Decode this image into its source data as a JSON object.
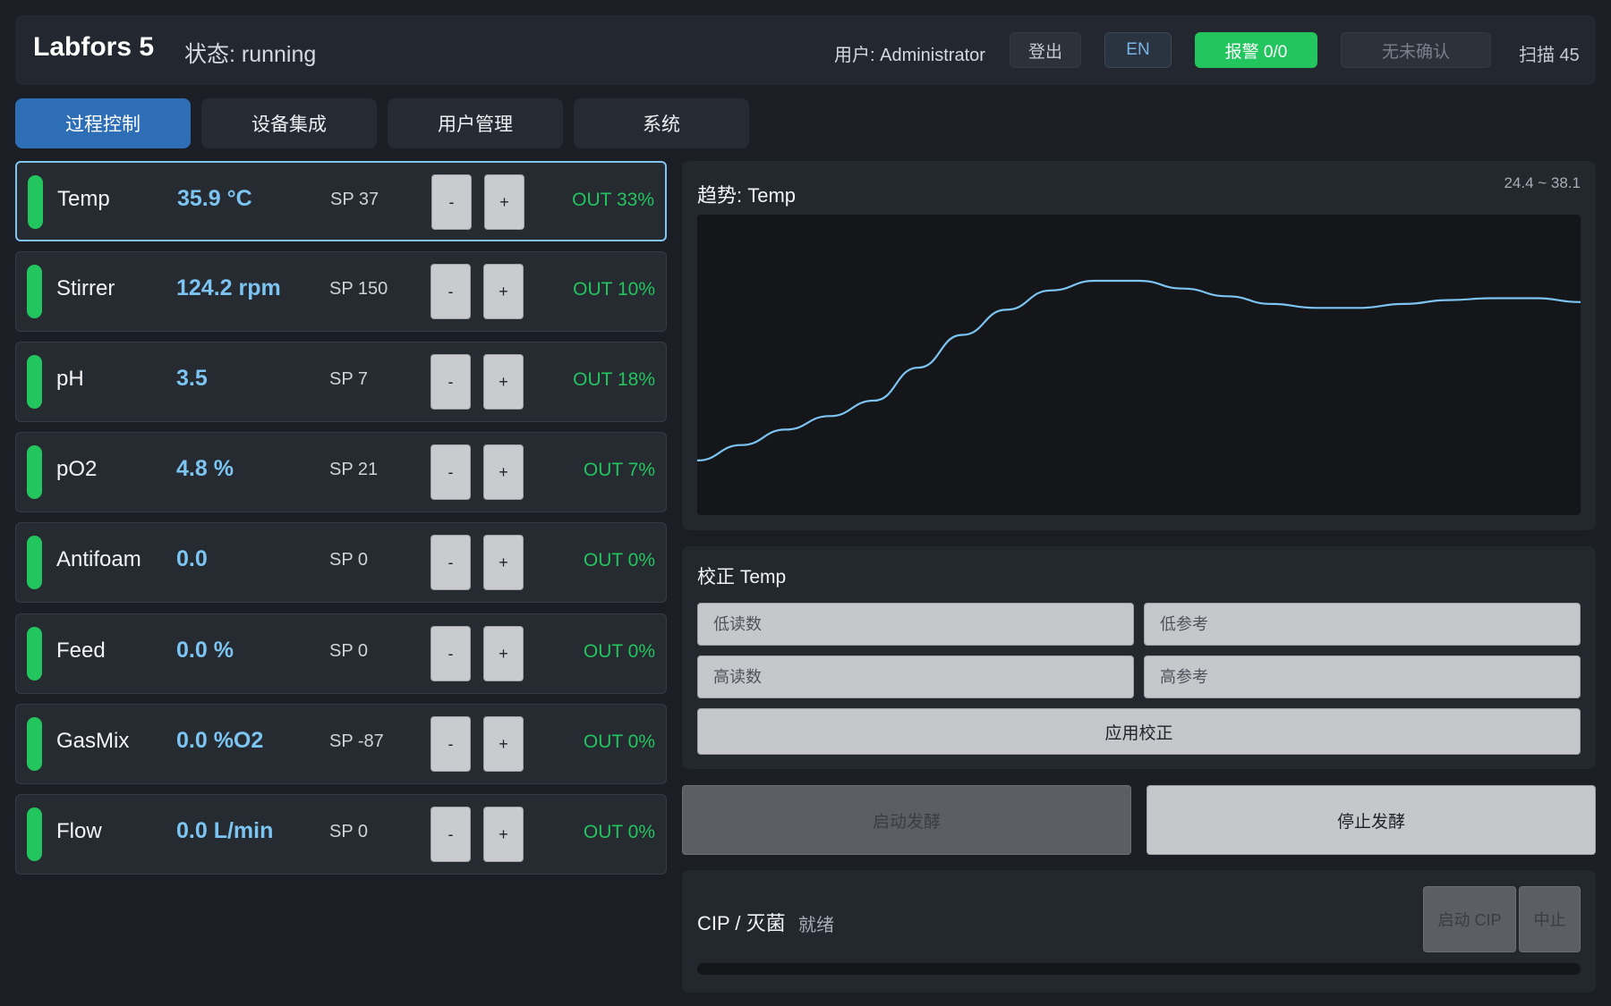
{
  "header": {
    "brand": "Labfors 5",
    "status": "状态: running",
    "user": "用户: Administrator",
    "logout_label": "登出",
    "language_label": "EN",
    "alarm_label": "报警 0/0",
    "ack_label": "无未确认",
    "scan_label": "扫描 45",
    "colors": {
      "accent": "#2e6eb7",
      "ok": "#22c55e",
      "value": "#7cc4f2"
    }
  },
  "tabs": [
    {
      "label": "过程控制",
      "active": true
    },
    {
      "label": "设备集成",
      "active": false
    },
    {
      "label": "用户管理",
      "active": false
    },
    {
      "label": "系统",
      "active": false
    }
  ],
  "loops": [
    {
      "name": "Temp",
      "value": "35.9 °C",
      "sp": "SP 37",
      "out": "OUT 33%",
      "minus": "-",
      "plus": "+"
    },
    {
      "name": "Stirrer",
      "value": "124.2 rpm",
      "sp": "SP 150",
      "out": "OUT 10%",
      "minus": "-",
      "plus": "+"
    },
    {
      "name": "pH",
      "value": "3.5",
      "sp": "SP 7",
      "out": "OUT 18%",
      "minus": "-",
      "plus": "+"
    },
    {
      "name": "pO2",
      "value": "4.8 %",
      "sp": "SP 21",
      "out": "OUT 7%",
      "minus": "-",
      "plus": "+"
    },
    {
      "name": "Antifoam",
      "value": "0.0",
      "sp": "SP 0",
      "out": "OUT 0%",
      "minus": "-",
      "plus": "+"
    },
    {
      "name": "Feed",
      "value": "0.0 %",
      "sp": "SP 0",
      "out": "OUT 0%",
      "minus": "-",
      "plus": "+"
    },
    {
      "name": "GasMix",
      "value": "0.0 %O2",
      "sp": "SP -87",
      "out": "OUT 0%",
      "minus": "-",
      "plus": "+"
    },
    {
      "name": "Flow",
      "value": "0.0 L/min",
      "sp": "SP 0",
      "out": "OUT 0%",
      "minus": "-",
      "plus": "+"
    }
  ],
  "trend": {
    "title": "趋势: Temp",
    "range": "24.4 ~ 38.1",
    "y_min": 24.4,
    "y_max": 38.1,
    "line_color": "#7cc4f2",
    "values": [
      26.3,
      27.1,
      27.9,
      28.6,
      29.4,
      31.1,
      32.8,
      34.1,
      35.1,
      35.6,
      35.6,
      35.2,
      34.8,
      34.4,
      34.2,
      34.2,
      34.4,
      34.6,
      34.7,
      34.7,
      34.5
    ]
  },
  "calibration": {
    "title": "校正 Temp",
    "low_reading_placeholder": "低读数",
    "low_reference_placeholder": "低参考",
    "high_reading_placeholder": "高读数",
    "high_reference_placeholder": "高参考",
    "apply_label": "应用校正"
  },
  "fermentation": {
    "start_label": "启动发酵",
    "stop_label": "停止发酵"
  },
  "cip": {
    "title": "CIP / 灭菌",
    "state": "就绪",
    "start_label": "启动 CIP",
    "abort_label": "中止",
    "progress": 0
  }
}
